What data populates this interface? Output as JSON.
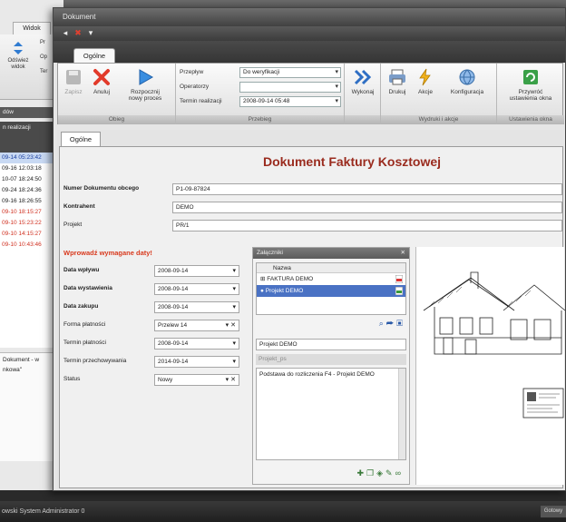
{
  "background_window": {
    "tab_widok": "Widok",
    "button_odswiez": "Odśwież\nwidok",
    "button_partial_1": "Pr",
    "button_partial_2": "Op",
    "button_partial_3": "Ter",
    "panel_title": "dów",
    "panel_subtitle": "n realizacji",
    "list_rows": [
      {
        "text": "09-14 05:23:42",
        "state": "sel"
      },
      {
        "text": "09-16 12:03:18",
        "state": "normal"
      },
      {
        "text": "10-07 18:24:50",
        "state": "normal"
      },
      {
        "text": "09-24 18:24:36",
        "state": "normal"
      },
      {
        "text": "09-16 18:26:55",
        "state": "normal"
      },
      {
        "text": "09-10 18:15:27",
        "state": "red"
      },
      {
        "text": "09-10 15:23:22",
        "state": "red"
      },
      {
        "text": "09-10 14:15:27",
        "state": "red"
      },
      {
        "text": "09-10 10:43:46",
        "state": "red"
      }
    ],
    "bottom_line1": "Dokument - w",
    "bottom_line2": "nkowa\""
  },
  "statusbar": {
    "text": "owski  System Administrator  0",
    "right": "Gotowy"
  },
  "window": {
    "title": "Dokument",
    "tab": "Ogólne"
  },
  "ribbon": {
    "groups": [
      {
        "label": "Obieg"
      },
      {
        "label": "Przebieg"
      },
      {
        "label": ""
      },
      {
        "label": "Wydruki i akcje"
      },
      {
        "label": "Ustawienia okna"
      }
    ],
    "buttons": {
      "zapisz": "Zapisz",
      "anuluj": "Anuluj",
      "rozpocznij": "Rozpocznij\nnowy proces",
      "wykonaj": "Wykonaj",
      "drukuj": "Drukuj",
      "akcje": "Akcje",
      "konfiguracja": "Konfiguracja",
      "przywroc": "Przywróć\nustawienia okna"
    },
    "fields": {
      "przeplyw_label": "Przepływ",
      "przeplyw_value": "Do weryfikacji",
      "operatorzy_label": "Operatorzy",
      "operatorzy_value": "",
      "termin_label": "Termin realizacji",
      "termin_value": "2008-09-14 05:48"
    }
  },
  "form": {
    "tab": "Ogólne",
    "title": "Dokument Faktury Kosztowej",
    "numer_label": "Numer Dokumentu obcego",
    "numer_value": "P1-09-87824",
    "kontrahent_label": "Kontrahent",
    "kontrahent_value": "DEMO",
    "projekt_label": "Projekt",
    "projekt_value": "PR/1",
    "warning": "Wprowadź wymagane daty!",
    "dates": [
      {
        "label": "Data wpływu",
        "value": "2008-09-14",
        "bold": true,
        "x": false
      },
      {
        "label": "Data wystawienia",
        "value": "2008-09-14",
        "bold": true,
        "x": false
      },
      {
        "label": "Data zakupu",
        "value": "2008-09-14",
        "bold": true,
        "x": false
      },
      {
        "label": "Forma płatności",
        "value": "Przelew 14",
        "bold": false,
        "x": true
      },
      {
        "label": "Termin płatności",
        "value": "2008-09-14",
        "bold": false,
        "x": false
      },
      {
        "label": "Termin przechowywania",
        "value": "2014-09-14",
        "bold": false,
        "x": false
      },
      {
        "label": "Status",
        "value": "Nowy",
        "bold": false,
        "x": true
      }
    ]
  },
  "attachments": {
    "header": "Załączniki",
    "column": "Nazwa",
    "rows": [
      {
        "name": "FAKTURA DEMO",
        "selected": false
      },
      {
        "name": "Projekt DEMO",
        "selected": true
      }
    ],
    "name_value": "Projekt DEMO",
    "sub_label": "Projekt_ps",
    "description": "Podstawa do rozliczenia F4 - Projekt DEMO"
  },
  "colors": {
    "title_red": "#9a2b1e",
    "warning_red": "#d83a1e",
    "selection_blue": "#4a72c4"
  }
}
